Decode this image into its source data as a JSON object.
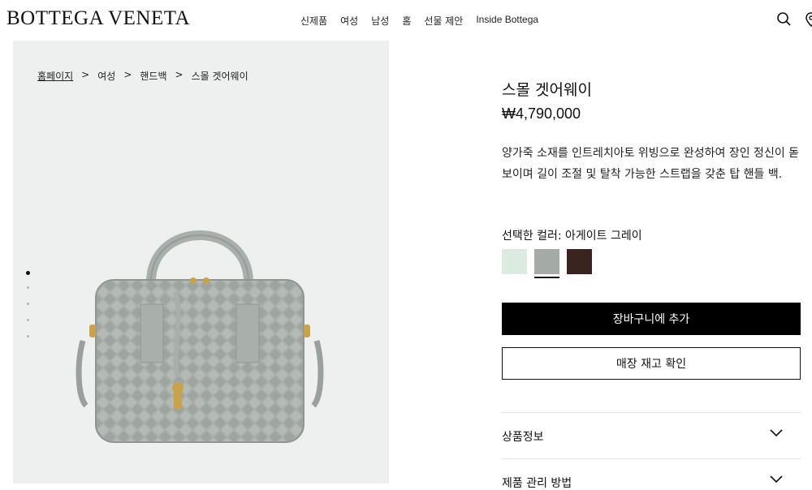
{
  "header": {
    "logo": "BOTTEGA VENETA",
    "nav": [
      "신제품",
      "여성",
      "남성",
      "홈",
      "선물 제안",
      "Inside Bottega"
    ]
  },
  "breadcrumb": {
    "items": [
      "홈페이지",
      "여성",
      "핸드백",
      "스몰 겟어웨이"
    ],
    "separator": ">"
  },
  "gallery": {
    "slide_count": 5,
    "active_slide": 1
  },
  "product": {
    "title": "스몰 겟어웨이",
    "price": "₩4,790,000",
    "description": "양가죽 소재를 인트레치아토 위빙으로 완성하여 장인 정신이 돋보이며 길이 조절 및 탈착 가능한 스트랩을 갖춘 탑 핸들 백.",
    "color_label": "선택한 컬러: 아게이트 그레이",
    "swatches": [
      {
        "color": "#dcebe0",
        "selected": false
      },
      {
        "color": "#a4aaa6",
        "selected": true
      },
      {
        "color": "#3a2420",
        "selected": false
      }
    ],
    "add_to_cart": "장바구니에 추가",
    "check_stock": "매장 재고 확인",
    "accordions": [
      "상품정보",
      "제품 관리 방법"
    ]
  },
  "colors": {
    "gallery_bg": "#eef0ef",
    "bag": "#a9b0ac",
    "hardware": "#c9a24a"
  }
}
